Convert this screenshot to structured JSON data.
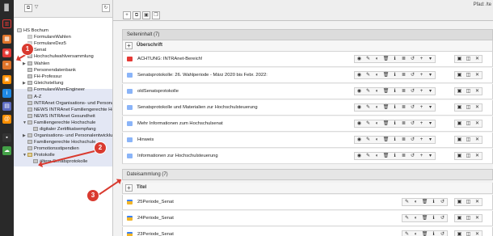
{
  "modules": [
    {
      "icon": "web-page-icon",
      "color": "#e0742a",
      "glyph": "▦"
    },
    {
      "icon": "view-icon",
      "color": "#e53935",
      "glyph": "◉"
    },
    {
      "icon": "list-icon",
      "color": "#e0742a",
      "glyph": "≡"
    },
    {
      "icon": "workspaces-icon",
      "color": "#ff8f00",
      "glyph": "▣"
    },
    {
      "icon": "info-icon",
      "color": "#1e88e5",
      "glyph": "i"
    },
    {
      "icon": "filelist-icon",
      "color": "#5c6bc0",
      "glyph": "▤"
    },
    {
      "icon": "email-icon",
      "color": "#ff8f00",
      "glyph": "@"
    },
    {
      "icon": "image-icon",
      "color": "#333333",
      "glyph": "▪"
    },
    {
      "icon": "cloud-icon",
      "color": "#43a047",
      "glyph": "☁"
    }
  ],
  "tree": [
    {
      "label": "HS Bochum",
      "type": "root"
    },
    {
      "label": "FormulareWahlen",
      "type": "hidden"
    },
    {
      "label": "FormulareDez5",
      "type": "hidden"
    },
    {
      "label": "Senat",
      "type": "page"
    },
    {
      "label": "Hochschulwahlversammlung",
      "type": "page"
    },
    {
      "label": "Wahlen",
      "type": "page"
    },
    {
      "label": "Personendatenbank",
      "type": "page"
    },
    {
      "label": "FH-Professur",
      "type": "page"
    },
    {
      "label": "Gleichstellung",
      "type": "page"
    },
    {
      "label": "FormulareWomEngineer",
      "type": "page"
    },
    {
      "label": "A-Z",
      "type": "page"
    },
    {
      "label": "INTRAnet Organisations- und Personal",
      "type": "page"
    },
    {
      "label": "NEWS INTRAnet Familiengerechte Hoch",
      "type": "page"
    },
    {
      "label": "NEWS INTRAnet Gesundheit",
      "type": "page"
    },
    {
      "label": "Familiengerechte Hochschule",
      "type": "page"
    },
    {
      "label": "digitaler Zertifikatsempfang",
      "type": "page"
    },
    {
      "label": "Organisations- und Personalentwicklu",
      "type": "page"
    },
    {
      "label": "Familiengerechte Hochschule",
      "type": "page"
    },
    {
      "label": "Promotionsstipendien",
      "type": "page"
    },
    {
      "label": "Protokolle",
      "type": "folder"
    },
    {
      "label": "ältere Senatsprotokolle",
      "type": "page"
    }
  ],
  "header": {
    "path": "Pfad: /te"
  },
  "sections": {
    "content": {
      "title": "Seiteninhalt (7)",
      "column": "Überschrift",
      "rows": [
        "ACHTUNG: INTRAnet-Bereich!",
        "Senatsprotokolle: 26. Wahlperiode - März 2020 bis Febr. 2022:",
        "oldSenatsprotokolle",
        "Senatsprotokolle und Materialien zur Hochschulsteuerung",
        "Mehr Informationen zum Hochschulsenat",
        "Hinweis",
        "Informationen zur Hochschulsteuerung"
      ]
    },
    "files": {
      "title": "Dateisammlung (7)",
      "column": "Titel",
      "rows": [
        "25Periode_Senat",
        "24Periode_Senat",
        "23Periode_Senat"
      ]
    }
  },
  "annotations": [
    "1",
    "2",
    "3"
  ]
}
